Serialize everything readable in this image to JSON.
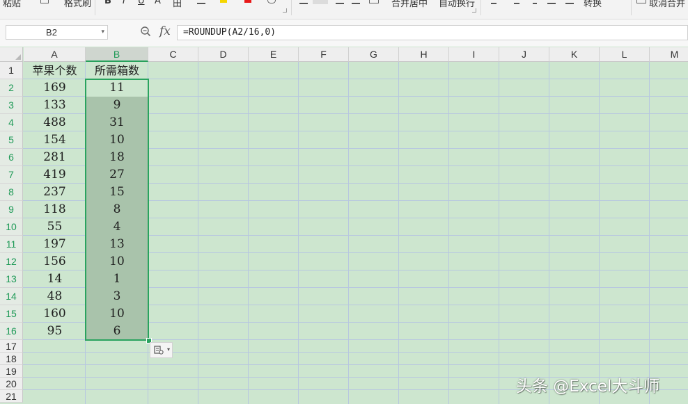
{
  "toolbar": {
    "items": [
      "粘贴",
      "格式刷",
      "B",
      "I",
      "U",
      "A",
      "田",
      "合并居中",
      "自动换行",
      "转换",
      "取消合并"
    ]
  },
  "formula_bar": {
    "name_box": "B2",
    "fx_label": "fx",
    "formula": "=ROUNDUP(A2/16,0)"
  },
  "columns": [
    "A",
    "B",
    "C",
    "D",
    "E",
    "F",
    "G",
    "H",
    "I",
    "J",
    "K",
    "L",
    "M"
  ],
  "selected_column": "B",
  "rows": [
    "1",
    "2",
    "3",
    "4",
    "5",
    "6",
    "7",
    "8",
    "9",
    "10",
    "11",
    "12",
    "13",
    "14",
    "15",
    "16",
    "17",
    "18",
    "19",
    "20",
    "21"
  ],
  "sheet": {
    "header_a": "苹果个数",
    "header_b": "所需箱数",
    "data": [
      {
        "a": "169",
        "b": "11"
      },
      {
        "a": "133",
        "b": "9"
      },
      {
        "a": "488",
        "b": "31"
      },
      {
        "a": "154",
        "b": "10"
      },
      {
        "a": "281",
        "b": "18"
      },
      {
        "a": "419",
        "b": "27"
      },
      {
        "a": "237",
        "b": "15"
      },
      {
        "a": "118",
        "b": "8"
      },
      {
        "a": "55",
        "b": "4"
      },
      {
        "a": "197",
        "b": "13"
      },
      {
        "a": "156",
        "b": "10"
      },
      {
        "a": "14",
        "b": "1"
      },
      {
        "a": "48",
        "b": "3"
      },
      {
        "a": "160",
        "b": "10"
      },
      {
        "a": "95",
        "b": "6"
      }
    ]
  },
  "watermark": "头条 @Excel大斗师",
  "colors": {
    "grid_background": "#cde6cf",
    "selection_fill": "#a9c3ab",
    "selection_border": "#2aa35f",
    "gridline": "#b7c7e0"
  },
  "icons": [
    "zoom-icon",
    "fx-icon",
    "paste-options-icon",
    "dropdown-arrow-icon"
  ]
}
